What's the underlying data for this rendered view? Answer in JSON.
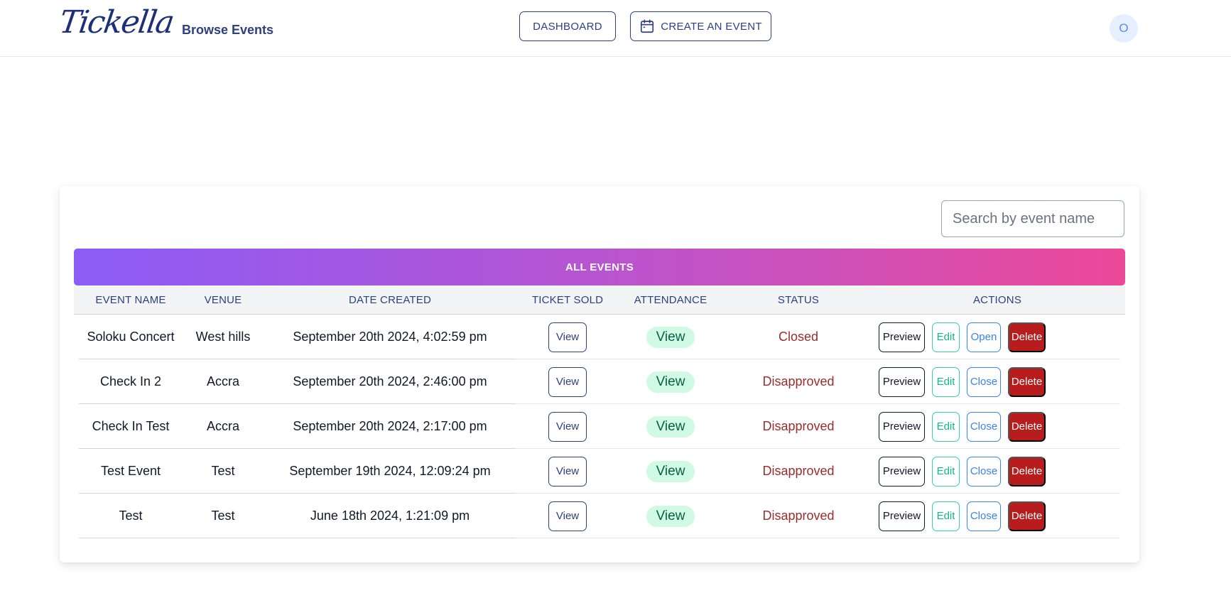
{
  "header": {
    "logo_text": "Tickella",
    "browse_link": "Browse Events",
    "dashboard_label": "DASHBOARD",
    "create_label": "CREATE AN EVENT",
    "avatar_initial": "O"
  },
  "search": {
    "placeholder": "Search by event name",
    "value": ""
  },
  "table": {
    "title": "ALL EVENTS",
    "columns": [
      "EVENT NAME",
      "VENUE",
      "DATE CREATED",
      "TICKET SOLD",
      "ATTENDANCE",
      "STATUS",
      "ACTIONS"
    ],
    "rows": [
      {
        "name": "Soloku Concert",
        "venue": "West hills",
        "date": "September 20th 2024, 4:02:59 pm",
        "ticket_label": "View",
        "attendance_label": "View",
        "status": "Closed",
        "preview": "Preview",
        "edit": "Edit",
        "toggle": "Open",
        "delete": "Delete"
      },
      {
        "name": "Check In 2",
        "venue": "Accra",
        "date": "September 20th 2024, 2:46:00 pm",
        "ticket_label": "View",
        "attendance_label": "View",
        "status": "Disapproved",
        "preview": "Preview",
        "edit": "Edit",
        "toggle": "Close",
        "delete": "Delete"
      },
      {
        "name": "Check In Test",
        "venue": "Accra",
        "date": "September 20th 2024, 2:17:00 pm",
        "ticket_label": "View",
        "attendance_label": "View",
        "status": "Disapproved",
        "preview": "Preview",
        "edit": "Edit",
        "toggle": "Close",
        "delete": "Delete"
      },
      {
        "name": "Test Event",
        "venue": "Test",
        "date": "September 19th 2024, 12:09:24 pm",
        "ticket_label": "View",
        "attendance_label": "View",
        "status": "Disapproved",
        "preview": "Preview",
        "edit": "Edit",
        "toggle": "Close",
        "delete": "Delete"
      },
      {
        "name": "Test",
        "venue": "Test",
        "date": "June 18th 2024, 1:21:09 pm",
        "ticket_label": "View",
        "attendance_label": "View",
        "status": "Disapproved",
        "preview": "Preview",
        "edit": "Edit",
        "toggle": "Close",
        "delete": "Delete"
      }
    ]
  },
  "colors": {
    "brand": "#2e3f7e",
    "gradient_start": "#8b5cf6",
    "gradient_end": "#ec4899",
    "status_red": "#9b2c2c",
    "delete_red": "#b91c1c",
    "edit_green": "#10b981",
    "toggle_blue": "#3b82f6",
    "attendance_pill": "#d1fae5"
  },
  "icons": {
    "create_button": "calendar-icon"
  }
}
